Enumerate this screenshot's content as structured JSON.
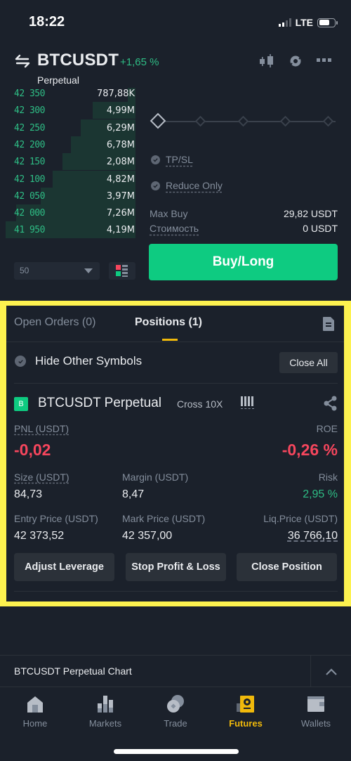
{
  "status_bar": {
    "time": "18:22",
    "network": "LTE"
  },
  "header": {
    "symbol": "BTCUSDT",
    "change": "+1,65 %",
    "subtitle": "Perpetual",
    "icons": [
      "candlestick-chart-icon",
      "swap-settings-icon",
      "more-icon"
    ]
  },
  "orderbook": {
    "bids": [
      {
        "price": "42 350",
        "qty": "787,88K",
        "depth": 0.06
      },
      {
        "price": "42 300",
        "qty": "4,99M",
        "depth": 0.33
      },
      {
        "price": "42 250",
        "qty": "6,29M",
        "depth": 0.42
      },
      {
        "price": "42 200",
        "qty": "6,78M",
        "depth": 0.5
      },
      {
        "price": "42 150",
        "qty": "2,08M",
        "depth": 0.56
      },
      {
        "price": "42 100",
        "qty": "4,82M",
        "depth": 0.64
      },
      {
        "price": "42 050",
        "qty": "3,97M",
        "depth": 0.73
      },
      {
        "price": "42 000",
        "qty": "7,26M",
        "depth": 0.92
      },
      {
        "price": "41 950",
        "qty": "4,19M",
        "depth": 1.0
      }
    ],
    "depth_select": "50"
  },
  "order_form": {
    "leverage_slider_steps": 5,
    "leverage_slider_selected": 0,
    "tpsl_label": "TP/SL",
    "reduce_only_label": "Reduce Only",
    "max_buy_label": "Max Buy",
    "max_buy_value": "29,82 USDT",
    "cost_label": "Стоимость",
    "cost_value": "0 USDT",
    "buy_button": "Buy/Long"
  },
  "positions_panel": {
    "tabs": [
      {
        "label": "Open Orders (0)",
        "active": false
      },
      {
        "label": "Positions (1)",
        "active": true
      }
    ],
    "hide_other_symbols": "Hide Other Symbols",
    "close_all": "Close All",
    "position": {
      "badge": "B",
      "title": "BTCUSDT Perpetual",
      "mode": "Cross 10X",
      "pnl_label": "PNL (USDT)",
      "pnl_value": "-0,02",
      "roe_label": "ROE",
      "roe_value": "-0,26 %",
      "size_label": "Size (USDT)",
      "size_value": "84,73",
      "margin_label": "Margin (USDT)",
      "margin_value": "8,47",
      "risk_label": "Risk",
      "risk_value": "2,95 %",
      "entry_label": "Entry Price (USDT)",
      "entry_value": "42 373,52",
      "mark_label": "Mark Price (USDT)",
      "mark_value": "42 357,00",
      "liq_label": "Liq.Price (USDT)",
      "liq_value": "36 766,10"
    },
    "actions": [
      "Adjust Leverage",
      "Stop Profit & Loss",
      "Close Position"
    ]
  },
  "chart_bar": {
    "label": "BTCUSDT Perpetual  Chart"
  },
  "bottom_nav": [
    {
      "label": "Home",
      "icon": "home-icon",
      "active": false
    },
    {
      "label": "Markets",
      "icon": "markets-icon",
      "active": false
    },
    {
      "label": "Trade",
      "icon": "trade-icon",
      "active": false
    },
    {
      "label": "Futures",
      "icon": "futures-icon",
      "active": true
    },
    {
      "label": "Wallets",
      "icon": "wallet-icon",
      "active": false
    }
  ],
  "colors": {
    "background": "#1b212b",
    "buy": "#0ecb81",
    "up": "#2ebd85",
    "down": "#f6465d",
    "accent": "#f0b90b",
    "highlight": "#fdf24f"
  }
}
